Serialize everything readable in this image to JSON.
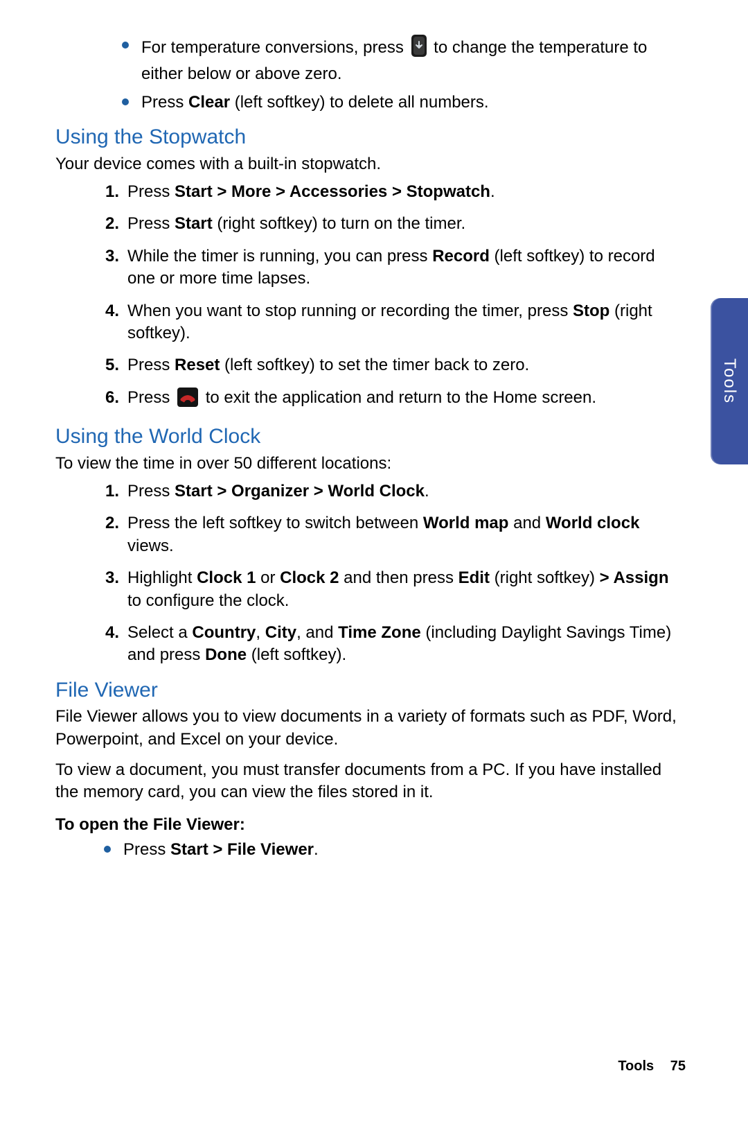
{
  "top_bullets": [
    {
      "parts": [
        {
          "t": "For temperature conversions, press "
        },
        {
          "icon": "down-key"
        },
        {
          "t": " to change the temperature to either below or above zero."
        }
      ]
    },
    {
      "parts": [
        {
          "t": "Press "
        },
        {
          "b": "Clear"
        },
        {
          "t": " (left softkey) to delete all numbers."
        }
      ]
    }
  ],
  "stopwatch": {
    "heading": "Using the Stopwatch",
    "intro": "Your device comes with a built-in stopwatch.",
    "steps": [
      [
        {
          "t": "Press "
        },
        {
          "b": "Start > More > Accessories > Stopwatch"
        },
        {
          "t": "."
        }
      ],
      [
        {
          "t": "Press "
        },
        {
          "b": "Start"
        },
        {
          "t": " (right softkey) to turn on the timer."
        }
      ],
      [
        {
          "t": "While the timer is running, you can press "
        },
        {
          "b": "Record"
        },
        {
          "t": " (left softkey) to record one or more time lapses."
        }
      ],
      [
        {
          "t": "When you want to stop running or recording the timer, press "
        },
        {
          "b": "Stop"
        },
        {
          "t": " (right softkey)."
        }
      ],
      [
        {
          "t": "Press "
        },
        {
          "b": "Reset"
        },
        {
          "t": " (left softkey) to set the timer back to zero."
        }
      ],
      [
        {
          "t": "Press "
        },
        {
          "icon": "hangup-key"
        },
        {
          "t": " to exit the application and return to the Home screen."
        }
      ]
    ]
  },
  "worldclock": {
    "heading": "Using the World Clock",
    "intro": "To view the time in over 50 different locations:",
    "steps": [
      [
        {
          "t": "Press "
        },
        {
          "b": "Start > Organizer > World Clock"
        },
        {
          "t": "."
        }
      ],
      [
        {
          "t": "Press the left softkey to switch between "
        },
        {
          "b": "World map"
        },
        {
          "t": " and "
        },
        {
          "b": "World clock"
        },
        {
          "t": " views."
        }
      ],
      [
        {
          "t": "Highlight "
        },
        {
          "b": "Clock 1"
        },
        {
          "t": " or "
        },
        {
          "b": "Clock 2"
        },
        {
          "t": " and then press "
        },
        {
          "b": "Edit"
        },
        {
          "t": " (right softkey) "
        },
        {
          "b": "> Assign"
        },
        {
          "t": " to configure the clock."
        }
      ],
      [
        {
          "t": "Select a "
        },
        {
          "b": "Country"
        },
        {
          "t": ", "
        },
        {
          "b": "City"
        },
        {
          "t": ", and "
        },
        {
          "b": "Time Zone"
        },
        {
          "t": " (including Daylight Savings Time) and press "
        },
        {
          "b": "Done"
        },
        {
          "t": " (left softkey)."
        }
      ]
    ]
  },
  "fileviewer": {
    "heading": "File Viewer",
    "para1": "File Viewer allows you to view documents in a variety of formats such as PDF, Word, Powerpoint, and Excel on your device.",
    "para2": "To view a document, you must transfer documents from a PC. If you have installed the memory card, you can view the files stored in it.",
    "subhead": "To open the File Viewer:",
    "bullet": [
      {
        "t": "Press "
      },
      {
        "b": "Start > File Viewer"
      },
      {
        "t": "."
      }
    ]
  },
  "tab_label": "Tools",
  "footer": {
    "section": "Tools",
    "page": "75"
  }
}
